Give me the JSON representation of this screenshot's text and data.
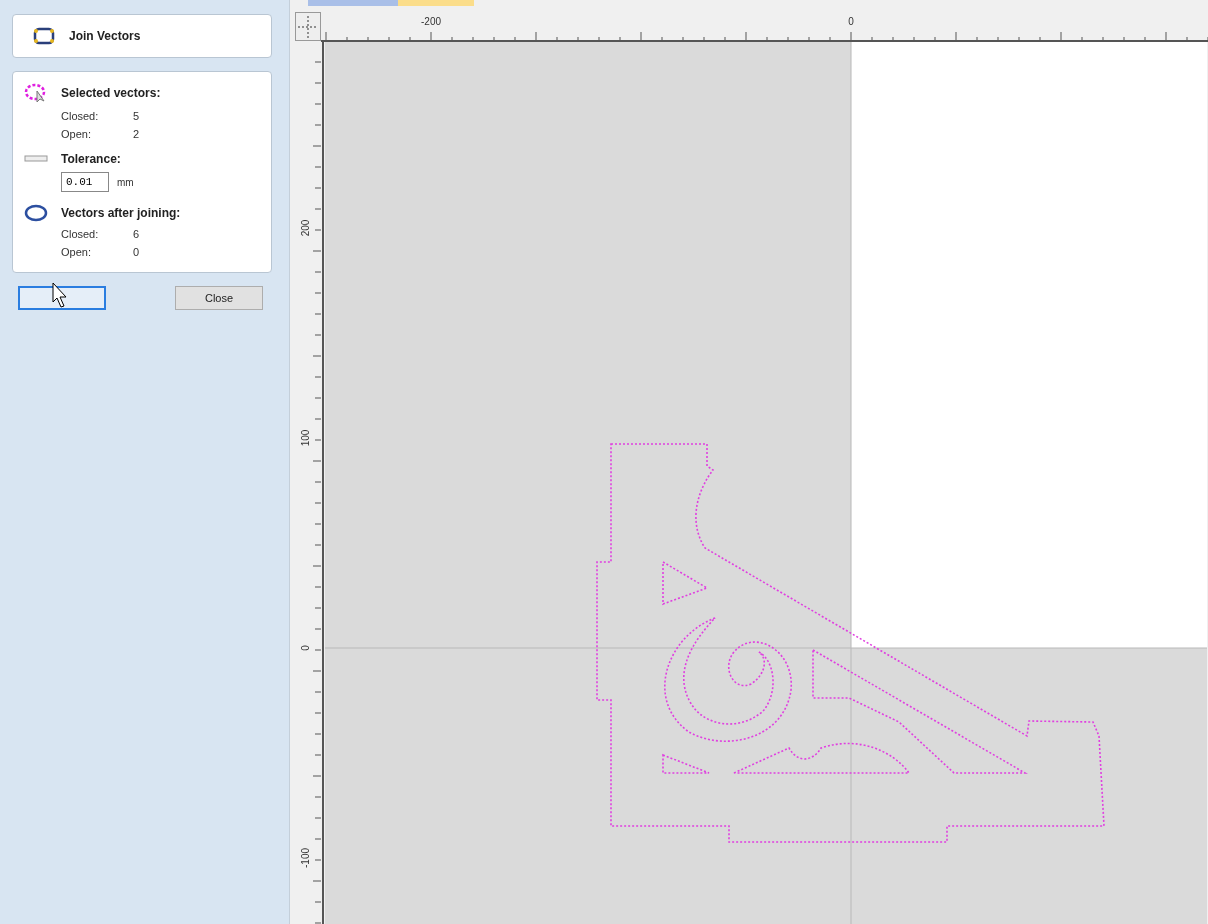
{
  "panel": {
    "title": "Join Vectors"
  },
  "sections": [
    {
      "kind": "selected",
      "title": "Selected vectors:",
      "rows": [
        {
          "label": "Closed:",
          "value": "5"
        },
        {
          "label": "Open:",
          "value": "2"
        }
      ]
    },
    {
      "kind": "tolerance",
      "title": "Tolerance:",
      "value": "0.01",
      "unit": "mm"
    },
    {
      "kind": "result",
      "title": "Vectors after joining:",
      "rows": [
        {
          "label": "Closed:",
          "value": "6"
        },
        {
          "label": "Open:",
          "value": "0"
        }
      ]
    }
  ],
  "buttons": [
    {
      "kind": "blank",
      "focused": true
    },
    {
      "kind": "text",
      "label": "Close",
      "focused": false
    }
  ],
  "tabs": [
    {
      "color": "#a9bfe8"
    },
    {
      "color": "#fbdd8a"
    }
  ],
  "ruler": {
    "top_labels": [
      "-200",
      "0"
    ],
    "left_labels": [
      "200",
      "100",
      "0",
      "-100"
    ]
  }
}
